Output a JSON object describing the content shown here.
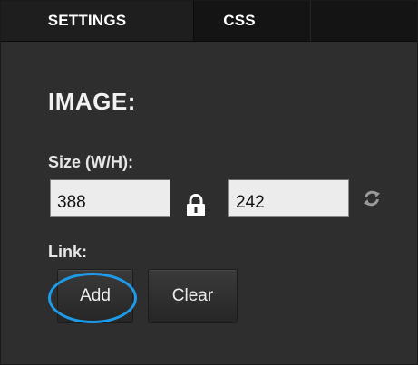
{
  "tabs": [
    {
      "label": "SETTINGS",
      "active": true
    },
    {
      "label": "CSS",
      "active": false
    }
  ],
  "section": {
    "title": "IMAGE:"
  },
  "size": {
    "label": "Size (W/H):",
    "width_value": "388",
    "height_value": "242",
    "lock_icon": "lock-icon",
    "refresh_icon": "refresh-icon"
  },
  "link": {
    "label": "Link:",
    "add_label": "Add",
    "clear_label": "Clear"
  },
  "colors": {
    "panel_background": "#2e2e2e",
    "tab_bar_background": "#141414",
    "active_tab_background": "#1e1e1e",
    "input_background": "#ececec",
    "highlight": "#1e9be8",
    "text": "#ffffff"
  }
}
